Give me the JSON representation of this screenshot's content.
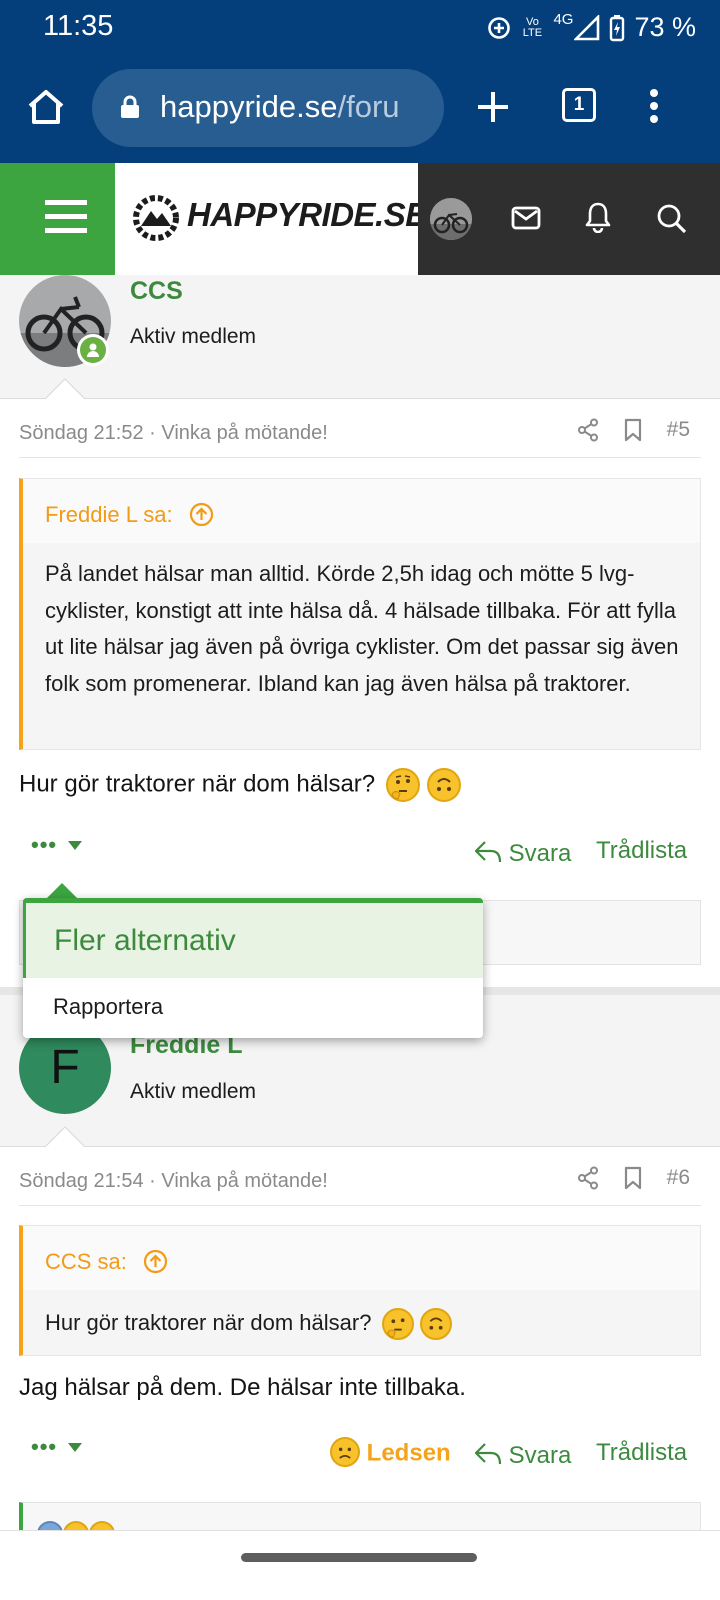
{
  "status_bar": {
    "time": "11:35",
    "network": "4G",
    "volte": "Vo LTE",
    "battery": "73 %"
  },
  "browser": {
    "url_host": "happyride.se",
    "url_path": "/foru",
    "tab_count": "1"
  },
  "site": {
    "logo_text": "HAPPYRIDE.SE",
    "brand_green": "#3da53f",
    "header_dark": "#2f2f2f"
  },
  "posts": [
    {
      "author": "CCS",
      "author_title": "Aktiv medlem",
      "date": "Söndag 21:52",
      "thread_title": "· Vinka på mötande!",
      "number": "#5",
      "quote_author": "Freddie L sa:",
      "quote_text": "På landet hälsar man alltid. Körde 2,5h idag och mötte 5 lvg-cyklister, konstigt att inte hälsa då. 4 hälsade tillbaka. För att fylla ut lite hälsar jag även på övriga cyklister. Om det passar sig även folk som promenerar. Ibland kan jag även hälsa på traktorer.",
      "message": "Hur gör traktorer när dom hälsar?",
      "reply_label": "Svara",
      "thread_list_label": "Trådlista"
    },
    {
      "author": "Freddie L",
      "avatar_letter": "F",
      "author_title": "Aktiv medlem",
      "date": "Söndag 21:54",
      "thread_title": "· Vinka på mötande!",
      "number": "#6",
      "quote_author": "CCS sa:",
      "quote_text": "Hur gör traktorer när dom hälsar?",
      "message": "Jag hälsar på dem. De hälsar inte tillbaka.",
      "reaction_label": "Ledsen",
      "reply_label": "Svara",
      "thread_list_label": "Trådlista"
    }
  ],
  "dropdown": {
    "title": "Fler alternativ",
    "items": [
      "Rapportera"
    ]
  }
}
